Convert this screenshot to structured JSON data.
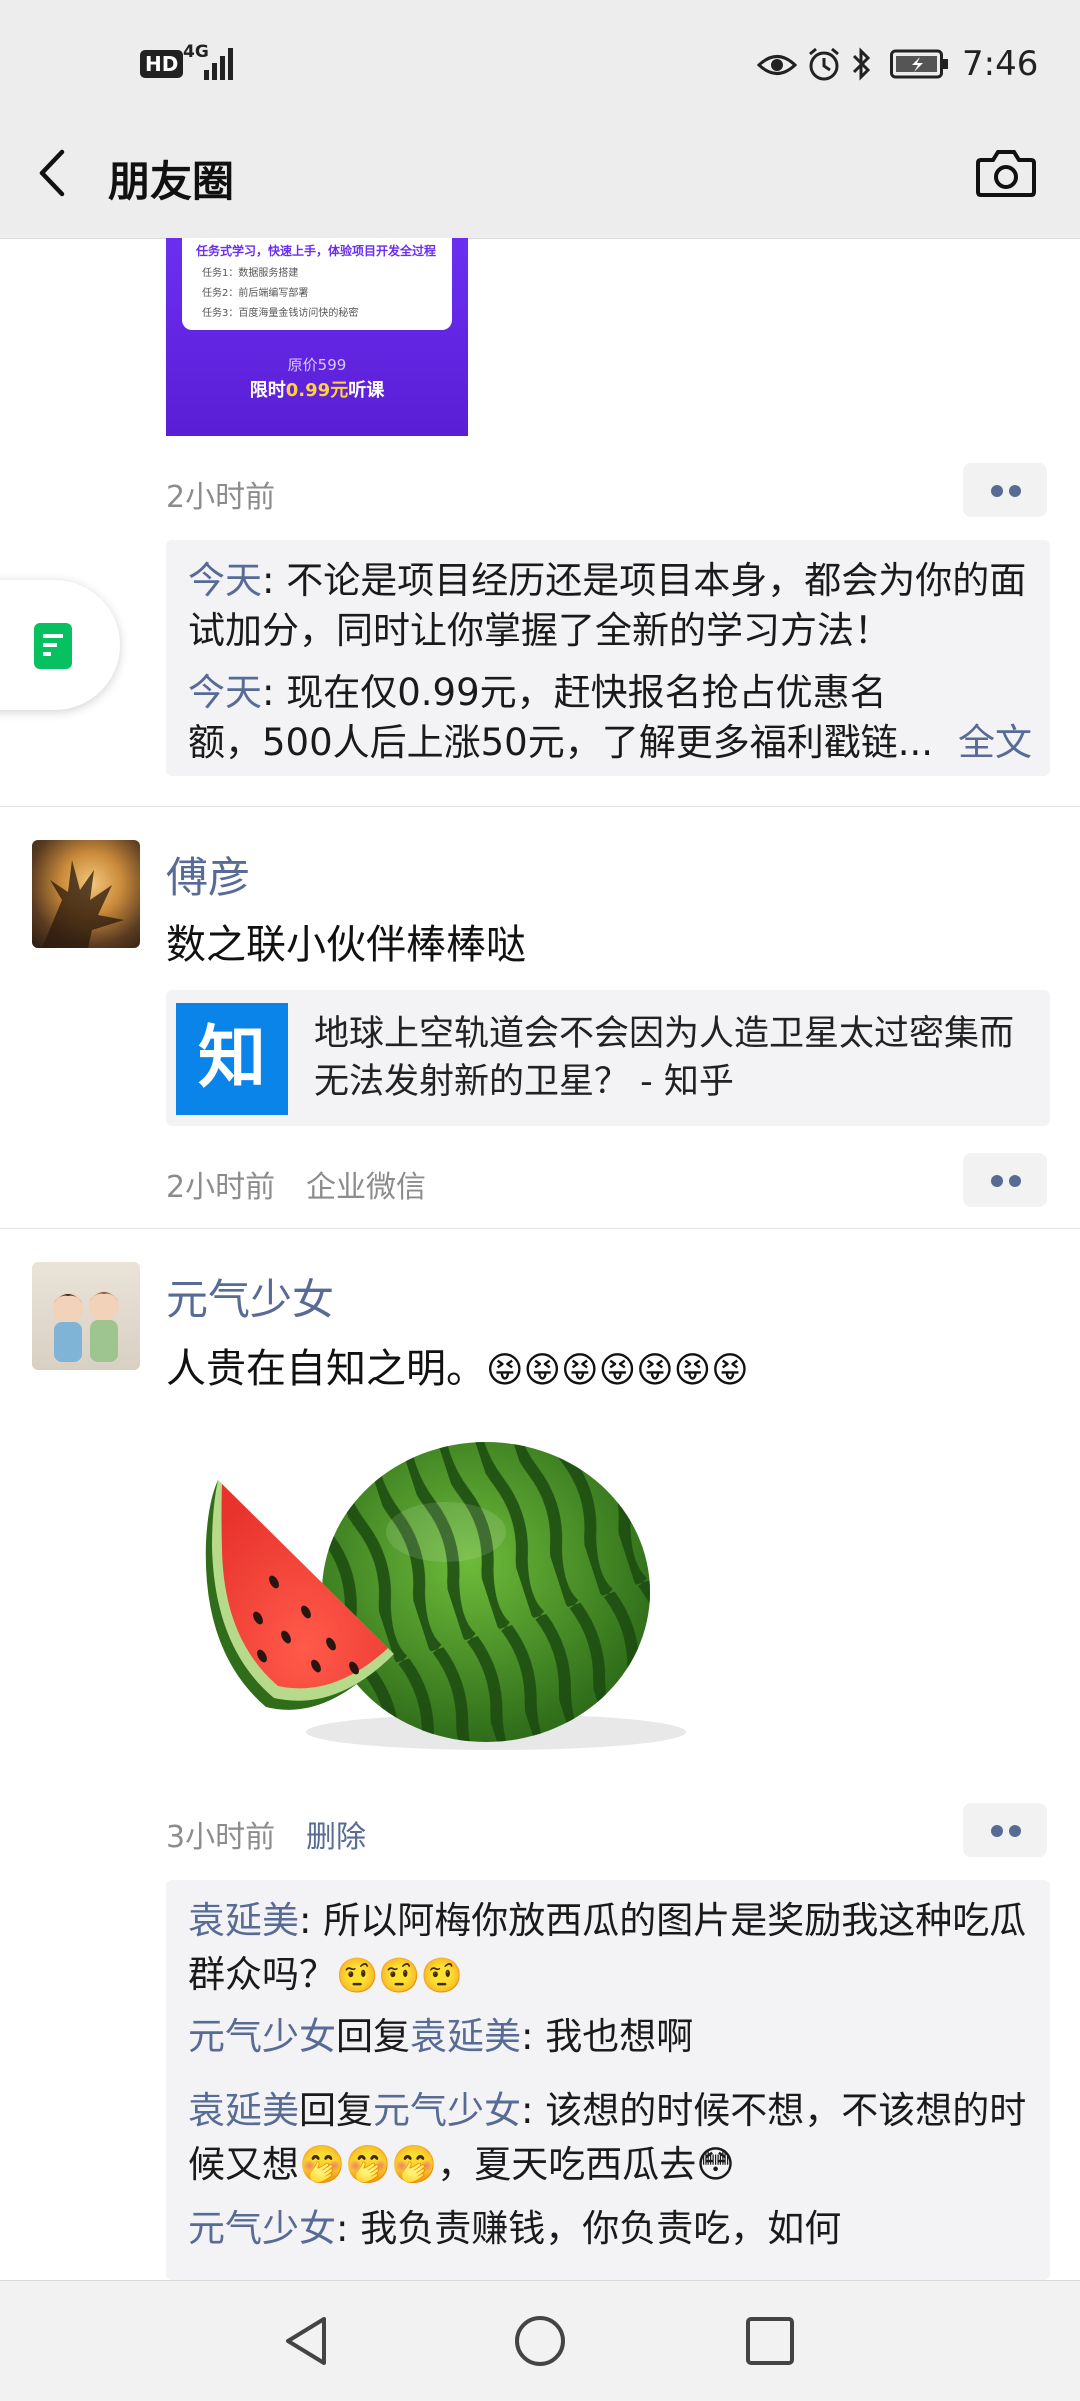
{
  "status_bar": {
    "badge_hd": "HD",
    "network": "4G",
    "time": "7:46"
  },
  "header": {
    "title": "朋友圈"
  },
  "post1": {
    "ad": {
      "heading": "任务式学习，快速上手，体验项目开发全过程",
      "tasks": [
        "任务1：数据服务搭建",
        "任务2：前后端编写部署",
        "任务3：百度海量金钱访问快的秘密"
      ],
      "original_price": "原价599",
      "promo": "限时0.99元听课",
      "promo_prefix": "限时",
      "promo_price": "0.99元",
      "promo_suffix": "听课"
    },
    "time": "2小时前",
    "comments": [
      {
        "author": "今天",
        "text": ": 不论是项目经历还是项目本身，都会为你的面试加分，同时让你掌握了全新的学习方法！"
      },
      {
        "author": "今天",
        "text": ": 现在仅0.99元，赶快报名抢占优惠名额，500人后上涨50元，了解更多福利戳链..."
      }
    ],
    "full_text": "全文"
  },
  "post2": {
    "name": "傅彦",
    "text": "数之联小伙伴棒棒哒",
    "link": {
      "icon_char": "知",
      "title": "地球上空轨道会不会因为人造卫星太过密集而无法发射新的卫星？ - 知乎"
    },
    "time": "2小时前",
    "source": "企业微信"
  },
  "post3": {
    "name": "元气少女",
    "text": "人贵在自知之明。",
    "emojis": "😝😝😝😝😝😝😝",
    "time": "3小时前",
    "delete": "删除",
    "comments": [
      {
        "author": "袁延美",
        "reply_word": "",
        "reply_to": "",
        "text": ": 所以阿梅你放西瓜的图片是奖励我这种吃瓜群众吗？",
        "emoji": "🤨🤨🤨"
      },
      {
        "author": "元气少女",
        "reply_word": "回复",
        "reply_to": "袁延美",
        "text": ": 我也想啊",
        "emoji": ""
      },
      {
        "author": "袁延美",
        "reply_word": "回复",
        "reply_to": "元气少女",
        "text": ": 该想的时候不想，不该想的时候又想🤭🤭🤭，夏天吃西瓜去😳",
        "emoji": ""
      },
      {
        "author": "元气少女",
        "reply_word": "",
        "reply_to": "",
        "text": ": 我负责赚钱，你负责吃，如何",
        "emoji": ""
      }
    ]
  },
  "icons": {
    "back": "chevron-left-icon",
    "camera": "camera-icon",
    "floating": "notes-icon",
    "nav_back": "triangle-back-icon",
    "nav_home": "circle-home-icon",
    "nav_recent": "square-recent-icon"
  },
  "colors": {
    "link_blue": "#576b95",
    "header_bg": "#ededed",
    "wechat_green": "#07c160",
    "zhihu_blue": "#0a84e8"
  }
}
